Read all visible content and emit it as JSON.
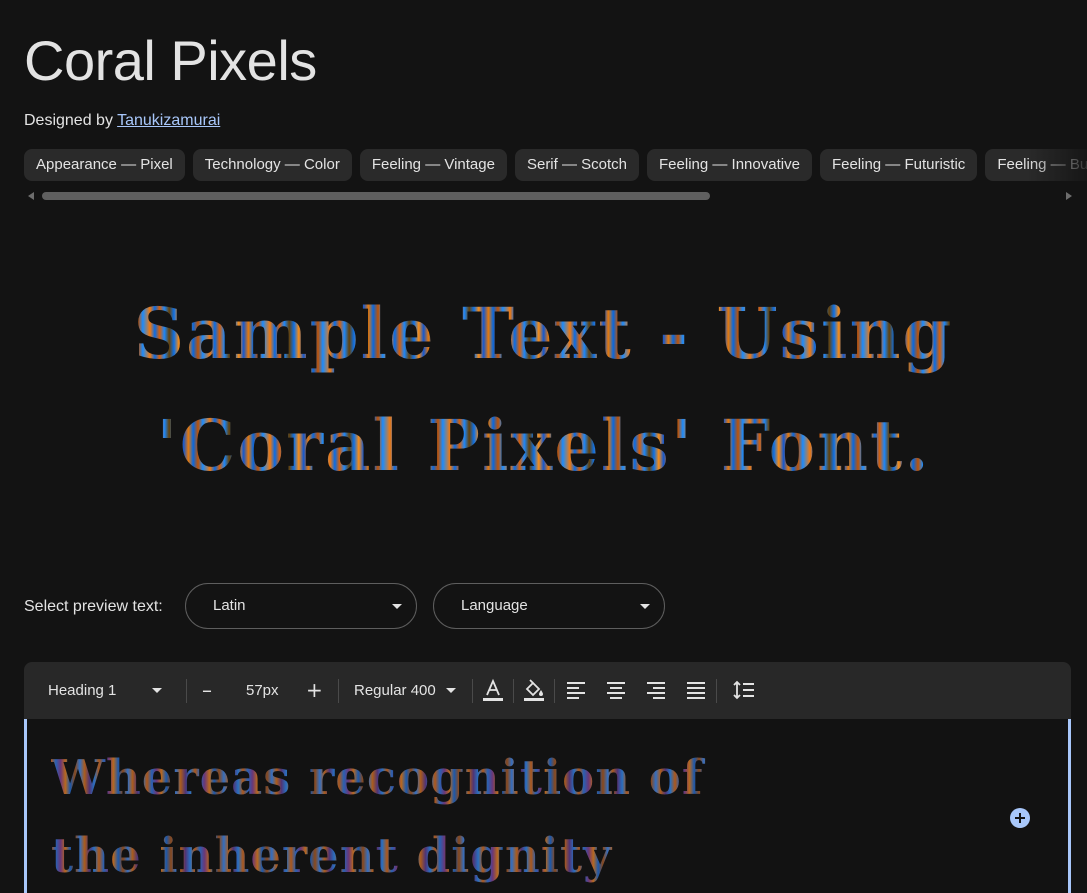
{
  "font": {
    "title": "Coral Pixels",
    "designed_by_label": "Designed by",
    "designer": "Tanukizamurai"
  },
  "tags": [
    "Appearance — Pixel",
    "Technology — Color",
    "Feeling — Vintage",
    "Serif — Scotch",
    "Feeling — Innovative",
    "Feeling — Futuristic",
    "Feeling — Business"
  ],
  "tags_scroll": {
    "visible_fraction": 0.66,
    "position_fraction": 0.0
  },
  "sample": {
    "text": "Sample Text - Using 'Coral Pixels' Font."
  },
  "preview": {
    "label": "Select preview text:",
    "script_value": "Latin",
    "language_value": "Language"
  },
  "toolbar": {
    "style_value": "Heading 1",
    "decrease_label": "–",
    "size_value": "57px",
    "increase_label": "+",
    "weight_value": "Regular 400"
  },
  "editor": {
    "text": "Whereas recognition of the inherent dignity"
  },
  "colors": {
    "background": "#131313",
    "accent": "#a8c7fa",
    "toolbar": "#282828",
    "chip": "#2a2a2a"
  }
}
